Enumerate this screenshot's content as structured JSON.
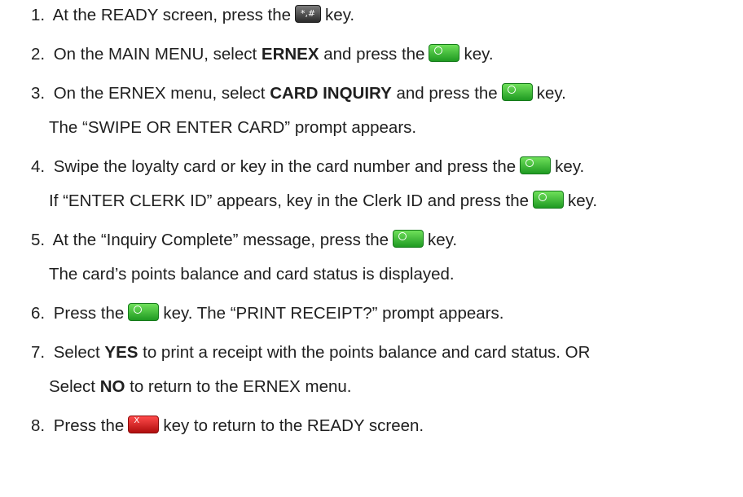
{
  "icons": {
    "star_hash_key": "star-hash-key-icon",
    "green_key": "green-enter-key-icon",
    "red_key": "red-cancel-key-icon"
  },
  "colors": {
    "green_key": "#2fbf2f",
    "red_key": "#e21b1b",
    "dark_key": "#3a3a3a"
  },
  "key_glyphs": {
    "star_hash": "*,#",
    "green": "○",
    "red": "X"
  },
  "steps": [
    {
      "n": "1.",
      "a": "At the READY screen, press the",
      "b": "key."
    },
    {
      "n": "2.",
      "a": "On the MAIN MENU, select",
      "bold": "ERNEX",
      "c": "and press the",
      "b": "key."
    },
    {
      "n": "3.",
      "a": "On the ERNEX menu, select",
      "bold": "CARD INQUIRY",
      "c": "and press the",
      "b": "key.",
      "note": "The “SWIPE OR ENTER CARD” prompt appears."
    },
    {
      "n": "4.",
      "a": "Swipe the loyalty card or key in the card number and press the",
      "b": "key.",
      "note_a": "If “ENTER CLERK ID” appears, key in the Clerk ID and press the",
      "note_b": "key."
    },
    {
      "n": "5.",
      "a": "At the “Inquiry Complete” message, press the",
      "b": "key.",
      "note": "The card’s points balance and card status is displayed."
    },
    {
      "n": "6.",
      "a": "Press the",
      "b": "key. The “PRINT RECEIPT?” prompt appears."
    },
    {
      "n": "7.",
      "a": "Select",
      "bold": "YES",
      "c": "to print a receipt with the points balance and card status. OR",
      "note_a": "Select",
      "note_bold": "NO",
      "note_b": "to return to the ERNEX menu."
    },
    {
      "n": "8.",
      "a": "Press the",
      "b": "key to return to the READY screen."
    }
  ]
}
